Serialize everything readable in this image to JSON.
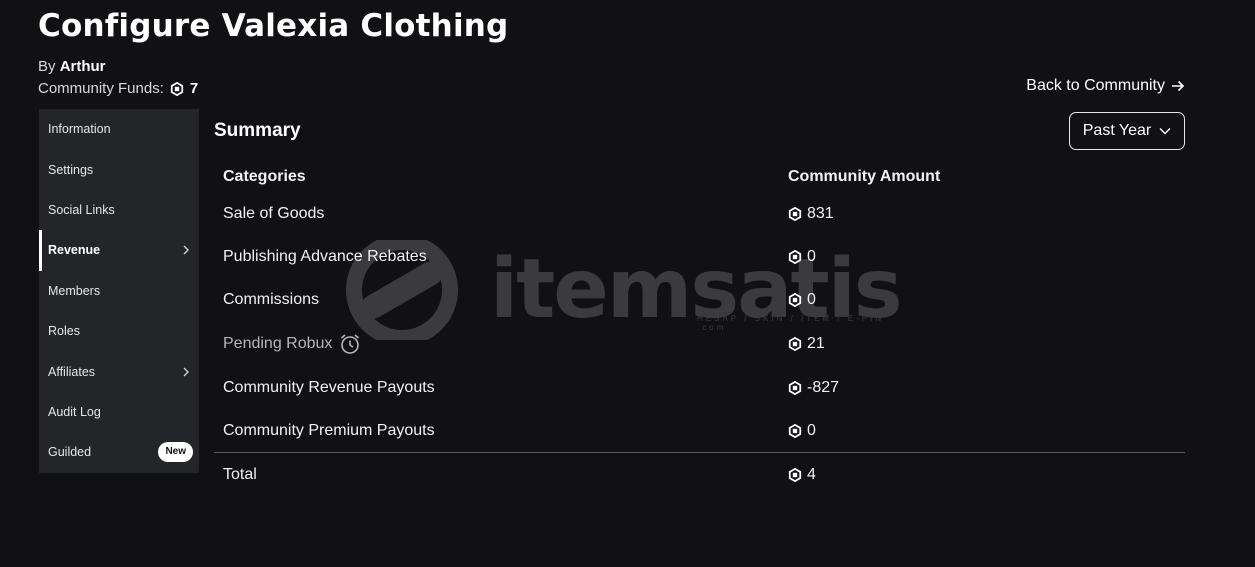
{
  "header": {
    "title": "Configure Valexia Clothing",
    "by_prefix": "By",
    "owner": "Arthur",
    "funds_label": "Community Funds:",
    "funds_value": "7",
    "back_link": "Back to Community"
  },
  "sidebar": {
    "items": [
      {
        "label": "Information"
      },
      {
        "label": "Settings"
      },
      {
        "label": "Social Links"
      },
      {
        "label": "Revenue"
      },
      {
        "label": "Members"
      },
      {
        "label": "Roles"
      },
      {
        "label": "Affiliates"
      },
      {
        "label": "Audit Log"
      },
      {
        "label": "Guilded"
      }
    ],
    "active_index": 3,
    "new_badge": "New"
  },
  "summary": {
    "title": "Summary",
    "period": "Past Year",
    "col_categories": "Categories",
    "col_amount": "Community Amount",
    "rows": [
      {
        "category": "Sale of Goods",
        "amount": "831"
      },
      {
        "category": "Publishing Advance Rebates",
        "amount": "0"
      },
      {
        "category": "Commissions",
        "amount": "0"
      },
      {
        "category": "Pending Robux",
        "amount": "21"
      },
      {
        "category": "Community Revenue Payouts",
        "amount": "-827"
      },
      {
        "category": "Community Premium Payouts",
        "amount": "0"
      }
    ],
    "total_label": "Total",
    "total_amount": "4"
  },
  "watermark": {
    "text": "itemsatis",
    "sub": "HESAP / SKIN / ITEM / E-PIN",
    "domain": ".com"
  },
  "colors": {
    "background": "#111114",
    "sidebar": "#232529",
    "text": "#ffffff",
    "muted": "#b5b6b8"
  }
}
